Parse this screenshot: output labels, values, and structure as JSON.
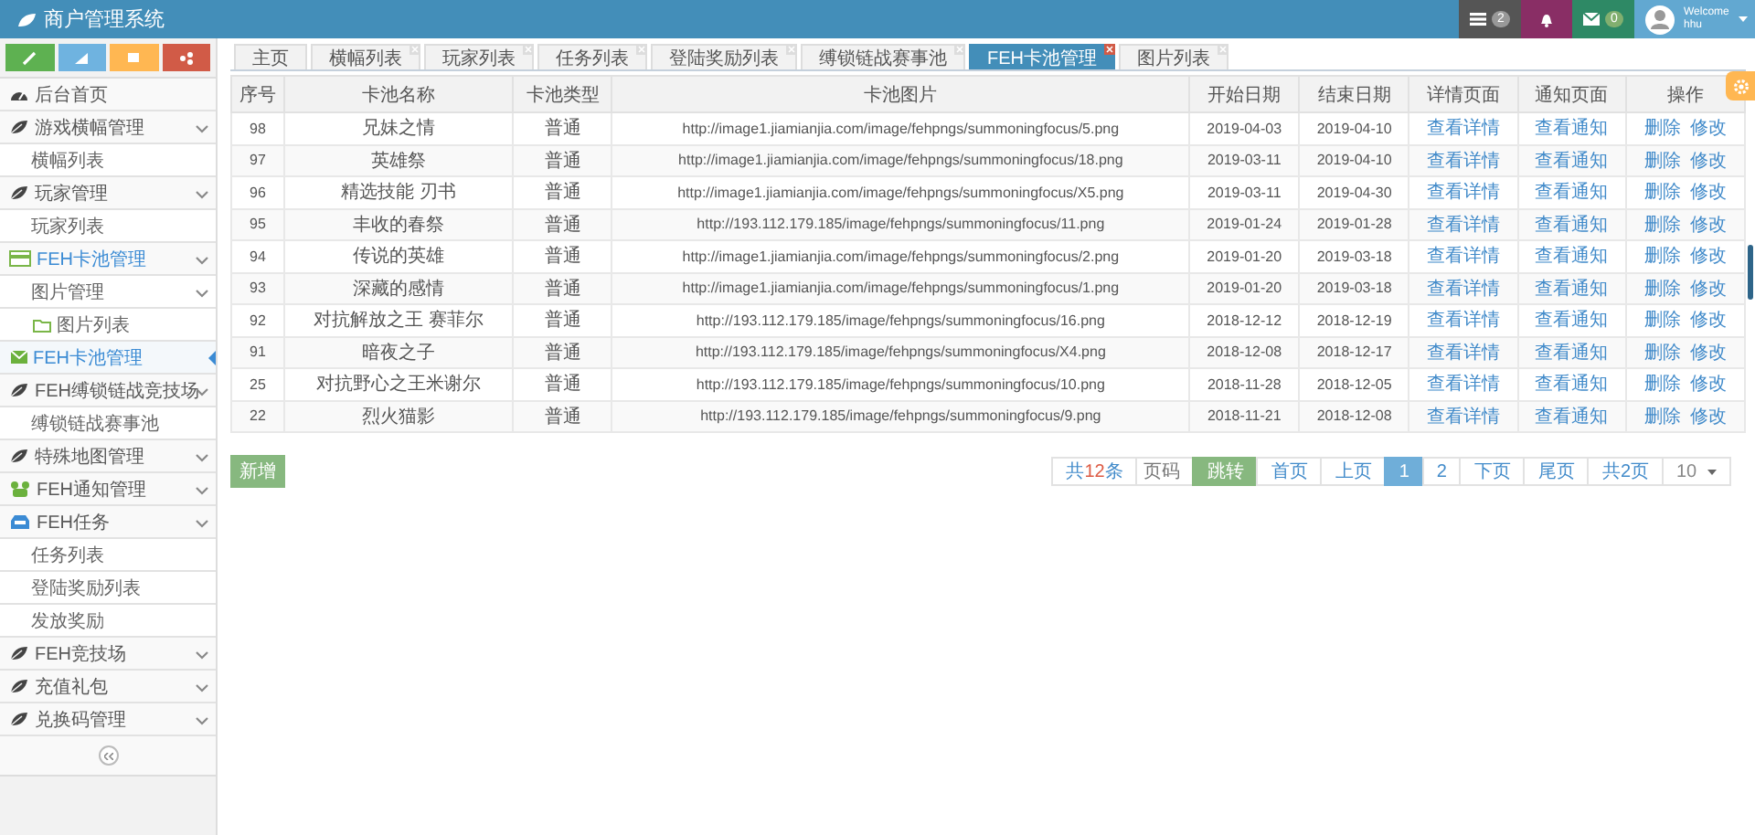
{
  "header": {
    "title": "商户管理系统",
    "task_count": "2",
    "mail_count": "0",
    "welcome": "Welcome",
    "user": "hhu"
  },
  "tabs": [
    {
      "label": "主页",
      "closable": false,
      "selected": false
    },
    {
      "label": "横幅列表",
      "closable": true,
      "selected": false
    },
    {
      "label": "玩家列表",
      "closable": true,
      "selected": false
    },
    {
      "label": "任务列表",
      "closable": true,
      "selected": false
    },
    {
      "label": "登陆奖励列表",
      "closable": true,
      "selected": false
    },
    {
      "label": "缚锁链战赛事池",
      "closable": true,
      "selected": false
    },
    {
      "label": "FEH卡池管理",
      "closable": true,
      "selected": true
    },
    {
      "label": "图片列表",
      "closable": true,
      "selected": false
    }
  ],
  "sidebar": {
    "items": [
      {
        "label": "后台首页",
        "active": false,
        "selected": false
      },
      {
        "label": "游戏横幅管理",
        "kind": "group",
        "active": false,
        "selected": false,
        "children": [
          {
            "label": "横幅列表",
            "selected": false
          }
        ]
      },
      {
        "label": "玩家管理",
        "kind": "group",
        "active": false,
        "selected": false,
        "children": [
          {
            "label": "玩家列表",
            "selected": false
          }
        ]
      },
      {
        "label": "FEH卡池管理",
        "kind": "group",
        "active": true,
        "selected": false,
        "children": [
          {
            "label": "图片管理",
            "kind": "group",
            "selected": false,
            "children": [
              {
                "label": "图片列表",
                "selected": false
              }
            ]
          },
          {
            "label": "FEH卡池管理",
            "selected": true
          }
        ]
      },
      {
        "label": "FEH缚锁链战竞技场",
        "kind": "group",
        "active": false,
        "selected": false,
        "children": [
          {
            "label": "缚锁链战赛事池",
            "selected": false
          }
        ]
      },
      {
        "label": "特殊地图管理",
        "kind": "group",
        "active": false,
        "selected": false
      },
      {
        "label": "FEH通知管理",
        "kind": "group",
        "active": false,
        "selected": false
      },
      {
        "label": "FEH任务",
        "kind": "group",
        "active": false,
        "selected": false,
        "children": [
          {
            "label": "任务列表",
            "selected": false
          },
          {
            "label": "登陆奖励列表",
            "selected": false
          },
          {
            "label": "发放奖励",
            "selected": false
          }
        ]
      },
      {
        "label": "FEH竞技场",
        "kind": "group",
        "active": false,
        "selected": false
      },
      {
        "label": "充值礼包",
        "kind": "group",
        "active": false,
        "selected": false
      },
      {
        "label": "兑换码管理",
        "kind": "group",
        "active": false,
        "selected": false
      }
    ]
  },
  "table": {
    "columns": [
      "序号",
      "卡池名称",
      "卡池类型",
      "卡池图片",
      "开始日期",
      "结束日期",
      "详情页面",
      "通知页面",
      "操作"
    ],
    "rows": [
      {
        "id": "98",
        "name": "兄妹之情",
        "type": "普通",
        "image": "http://image1.jiamianjia.com/image/fehpngs/summoningfocus/5.png",
        "start": "2019-04-03",
        "end": "2019-04-10",
        "detail": "查看详情",
        "notice": "查看通知",
        "actions": [
          "删除",
          "修改"
        ]
      },
      {
        "id": "97",
        "name": "英雄祭",
        "type": "普通",
        "image": "http://image1.jiamianjia.com/image/fehpngs/summoningfocus/18.png",
        "start": "2019-03-11",
        "end": "2019-04-10",
        "detail": "查看详情",
        "notice": "查看通知",
        "actions": [
          "删除",
          "修改"
        ]
      },
      {
        "id": "96",
        "name": "精选技能 刃书",
        "type": "普通",
        "image": "http://image1.jiamianjia.com/image/fehpngs/summoningfocus/X5.png",
        "start": "2019-03-11",
        "end": "2019-04-30",
        "detail": "查看详情",
        "notice": "查看通知",
        "actions": [
          "删除",
          "修改"
        ]
      },
      {
        "id": "95",
        "name": "丰收的春祭",
        "type": "普通",
        "image": "http://193.112.179.185/image/fehpngs/summoningfocus/11.png",
        "start": "2019-01-24",
        "end": "2019-01-28",
        "detail": "查看详情",
        "notice": "查看通知",
        "actions": [
          "删除",
          "修改"
        ]
      },
      {
        "id": "94",
        "name": "传说的英雄",
        "type": "普通",
        "image": "http://image1.jiamianjia.com/image/fehpngs/summoningfocus/2.png",
        "start": "2019-01-20",
        "end": "2019-03-18",
        "detail": "查看详情",
        "notice": "查看通知",
        "actions": [
          "删除",
          "修改"
        ]
      },
      {
        "id": "93",
        "name": "深藏的感情",
        "type": "普通",
        "image": "http://image1.jiamianjia.com/image/fehpngs/summoningfocus/1.png",
        "start": "2019-01-20",
        "end": "2019-03-18",
        "detail": "查看详情",
        "notice": "查看通知",
        "actions": [
          "删除",
          "修改"
        ]
      },
      {
        "id": "92",
        "name": "对抗解放之王 赛菲尔",
        "type": "普通",
        "image": "http://193.112.179.185/image/fehpngs/summoningfocus/16.png",
        "start": "2018-12-12",
        "end": "2018-12-19",
        "detail": "查看详情",
        "notice": "查看通知",
        "actions": [
          "删除",
          "修改"
        ]
      },
      {
        "id": "91",
        "name": "暗夜之子",
        "type": "普通",
        "image": "http://193.112.179.185/image/fehpngs/summoningfocus/X4.png",
        "start": "2018-12-08",
        "end": "2018-12-17",
        "detail": "查看详情",
        "notice": "查看通知",
        "actions": [
          "删除",
          "修改"
        ]
      },
      {
        "id": "25",
        "name": "对抗野心之王米谢尔",
        "type": "普通",
        "image": "http://193.112.179.185/image/fehpngs/summoningfocus/10.png",
        "start": "2018-11-28",
        "end": "2018-12-05",
        "detail": "查看详情",
        "notice": "查看通知",
        "actions": [
          "删除",
          "修改"
        ]
      },
      {
        "id": "22",
        "name": "烈火猫影",
        "type": "普通",
        "image": "http://193.112.179.185/image/fehpngs/summoningfocus/9.png",
        "start": "2018-11-21",
        "end": "2018-12-08",
        "detail": "查看详情",
        "notice": "查看通知",
        "actions": [
          "删除",
          "修改"
        ]
      }
    ]
  },
  "add_button": "新增",
  "pager": {
    "total_prefix": "共",
    "total": "12",
    "total_suffix": "条",
    "page_placeholder": "页码",
    "jump": "跳转",
    "first": "首页",
    "prev": "上页",
    "pages": [
      {
        "label": "1",
        "selected": true
      },
      {
        "label": "2",
        "selected": false
      }
    ],
    "next": "下页",
    "last": "尾页",
    "page_count": "共2页",
    "page_size": "10"
  }
}
